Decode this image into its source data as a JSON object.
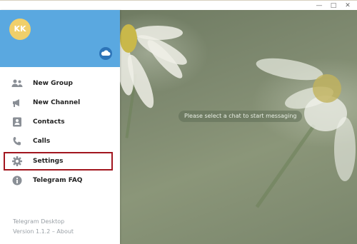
{
  "window": {
    "minimize_glyph": "—",
    "maximize_glyph": "□",
    "close_glyph": "✕"
  },
  "profile": {
    "initials": "KK",
    "avatar_color": "#f0cf6a",
    "header_color": "#5aa8e0"
  },
  "menu": {
    "items": [
      {
        "label": "New Group",
        "icon": "group-icon"
      },
      {
        "label": "New Channel",
        "icon": "megaphone-icon"
      },
      {
        "label": "Contacts",
        "icon": "contact-card-icon"
      },
      {
        "label": "Calls",
        "icon": "phone-icon"
      },
      {
        "label": "Settings",
        "icon": "gear-icon"
      },
      {
        "label": "Telegram FAQ",
        "icon": "info-icon"
      }
    ],
    "highlight_color": "#a2161f"
  },
  "footer": {
    "app_name": "Telegram Desktop",
    "version_text": "Version 1.1.2 – About"
  },
  "chat": {
    "empty_hint": "Please select a chat to start messaging"
  }
}
